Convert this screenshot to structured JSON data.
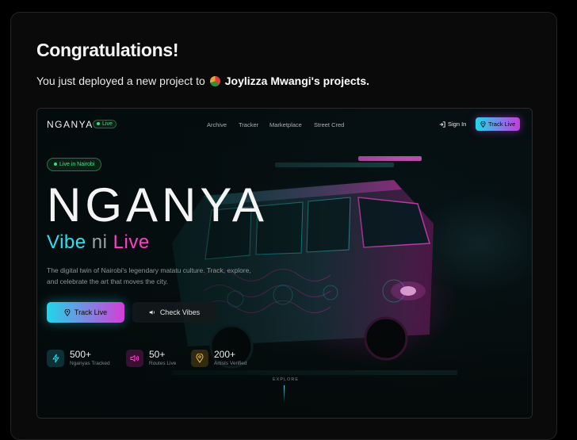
{
  "deploy": {
    "title": "Congratulations!",
    "message_prefix": "You just deployed a new project to",
    "team_name": "Joylizza Mwangi's projects."
  },
  "site": {
    "logo": "NGANYA",
    "live_badge": "Live",
    "nav_links": [
      "Archive",
      "Tracker",
      "Marketplace",
      "Street Cred"
    ],
    "sign_in": "Sign In",
    "track_live_nav": "Track Live",
    "location_pill": "Live in Nairobi",
    "hero_title": "NGANYA",
    "tagline": {
      "part1": "Vibe",
      "part2": "ni",
      "part3": "Live"
    },
    "description": "The digital twin of Nairobi's legendary matatu culture. Track, explore, and celebrate the art that moves the city.",
    "cta_primary": "Track Live",
    "cta_secondary": "Check Vibes",
    "stats": [
      {
        "value": "500+",
        "label": "Nganyas Tracked",
        "icon": "zap-icon",
        "color": "#2ee0f0"
      },
      {
        "value": "50+",
        "label": "Routes Live",
        "icon": "speaker-icon",
        "color": "#ff3fc8"
      },
      {
        "value": "200+",
        "label": "Artists Verified",
        "icon": "map-pin-icon",
        "color": "#e8b33b"
      }
    ],
    "explore": "EXPLORE"
  }
}
